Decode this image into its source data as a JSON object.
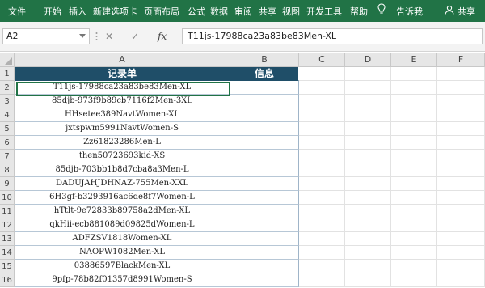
{
  "ribbon": {
    "tabs": [
      "文件",
      "开始",
      "插入",
      "新建选项卡",
      "页面布局",
      "公式",
      "数据",
      "审阅",
      "共享",
      "视图",
      "开发工具",
      "帮助"
    ],
    "tell_me": "告诉我",
    "share": "共享"
  },
  "formula_bar": {
    "name_box": "A2",
    "cancel": "✕",
    "enter": "✓",
    "fx": "fx",
    "content": "T11js-17988ca23a83be83Men-XL"
  },
  "columns": [
    "A",
    "B",
    "C",
    "D",
    "E",
    "F"
  ],
  "rows": [
    "1",
    "2",
    "3",
    "4",
    "5",
    "6",
    "7",
    "8",
    "9",
    "10",
    "11",
    "12",
    "13",
    "14",
    "15",
    "16"
  ],
  "table": {
    "header_a": "记录单",
    "header_b": "信息",
    "records": [
      "T11js-17988ca23a83be83Men-XL",
      "85djb-973f9b89cb7116f2Men-3XL",
      "HHsetee389NavtWomen-XL",
      "jxtspwm5991NavtWomen-S",
      "Zz61823286Men-L",
      "then50723693kid-XS",
      "85djb-703bb1b8d7cba8a3Men-L",
      "DADUJAHJDHNAZ-755Men-XXL",
      "6H3gf-b3293916ac6de8f7Women-L",
      "hTtlt-9e72833b89758a2dMen-XL",
      "qkHii-ecb881089d09825dWomen-L",
      "ADFZSV1818Women-XL",
      "NAOPW1082Men-XL",
      "03886597BlackMen-XL",
      "9pfp-78b82f01357d8991Women-S"
    ]
  }
}
